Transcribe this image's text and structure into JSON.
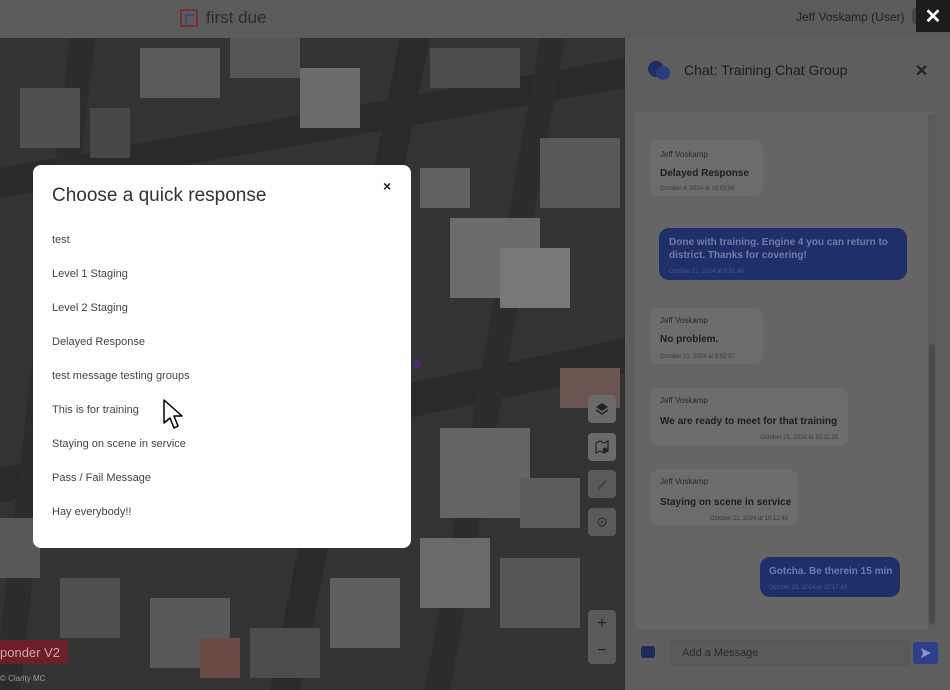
{
  "topbar": {
    "app_name": "first due",
    "user_label": "Jeff Voskamp (User)"
  },
  "map": {
    "responder_label": "ponder V2",
    "copyright": "© Clarity MC",
    "zoom_in": "+",
    "zoom_out": "−"
  },
  "chat": {
    "title": "Chat: Training Chat Group",
    "composer_placeholder": "Add a Message",
    "messages": [
      {
        "direction": "in",
        "author": "Jeff Voskamp",
        "text": "Delayed Response",
        "time": "October 4, 2024 at 18:53:56"
      },
      {
        "direction": "out",
        "author": "",
        "text": "Done with training. Engine 4 you can return to district. Thanks for covering!",
        "time": "October 21, 2024 at 9:51:49"
      },
      {
        "direction": "in",
        "author": "Jeff Voskamp",
        "text": "No problem.",
        "time": "October 21, 2024 at 9:52:37"
      },
      {
        "direction": "in",
        "author": "Jeff Voskamp",
        "text": "We are ready to meet for that training",
        "time": "October 21, 2024 at 10:11:35"
      },
      {
        "direction": "in",
        "author": "Jeff Voskamp",
        "text": "Staying on scene in service",
        "time": "October 21, 2024 at 10:12:40"
      },
      {
        "direction": "out",
        "author": "",
        "text": "Gotcha. Be therein 15 min",
        "time": "October 21, 2024 at 10:17:40"
      }
    ]
  },
  "modal": {
    "title": "Choose a quick response",
    "close_label": "×",
    "responses": [
      "test",
      "Level 1 Staging",
      "Level 2 Staging",
      "Delayed Response",
      "test message testing groups",
      "This is for training",
      "Staying on scene in service",
      "Pass / Fail Message",
      "Hay everybody!!"
    ]
  },
  "colors": {
    "accent": "#2d3e8a",
    "outgoing_bubble": "#1f2f6a",
    "brand_red": "#7a2e38"
  }
}
